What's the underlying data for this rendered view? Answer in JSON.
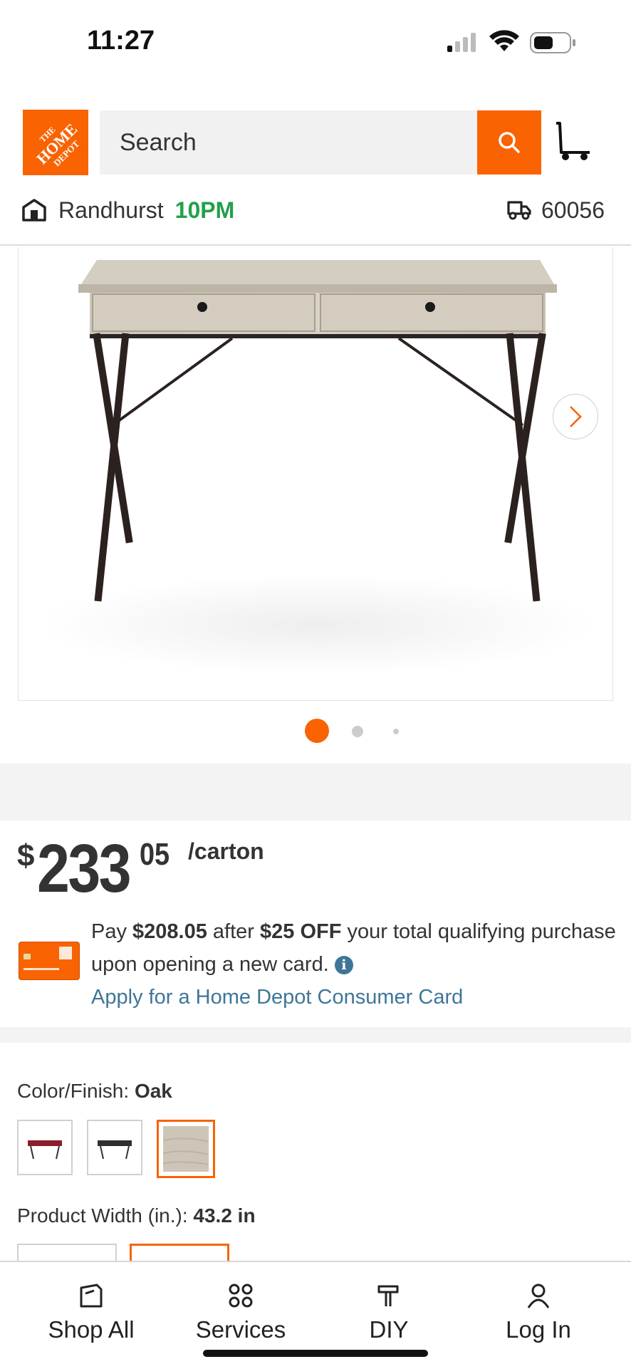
{
  "status": {
    "time": "11:27"
  },
  "header": {
    "logo_text": [
      "THE",
      "HOME",
      "DEPOT"
    ],
    "search_placeholder": "Search",
    "store_name": "Randhurst",
    "store_hours": "10PM",
    "zip": "60056"
  },
  "gallery": {
    "image_count": 3,
    "active_index": 0
  },
  "price": {
    "currency": "$",
    "whole": "233",
    "cents": "05",
    "unit": "/carton"
  },
  "promo": {
    "line_pre": "Pay ",
    "after_price": "$208.05",
    "line_mid": " after ",
    "discount": "$25 OFF",
    "line_post": " your total qualifying purchase upon opening a new card.",
    "info_glyph": "i",
    "apply_link": "Apply for a Home Depot Consumer Card"
  },
  "options": {
    "color_label": "Color/Finish: ",
    "color_value": "Oak",
    "swatches": [
      "Red",
      "Black",
      "Oak"
    ],
    "selected_swatch": 2,
    "width_label": "Product Width (in.): ",
    "width_value": "43.2 in"
  },
  "bottom_nav": [
    {
      "label": "Shop All",
      "icon": "shop-all-icon"
    },
    {
      "label": "Services",
      "icon": "services-icon"
    },
    {
      "label": "DIY",
      "icon": "diy-hammer-icon"
    },
    {
      "label": "Log In",
      "icon": "user-icon"
    }
  ],
  "colors": {
    "brand_orange": "#f96302",
    "open_green": "#22a04b",
    "link_blue": "#3e7697"
  }
}
